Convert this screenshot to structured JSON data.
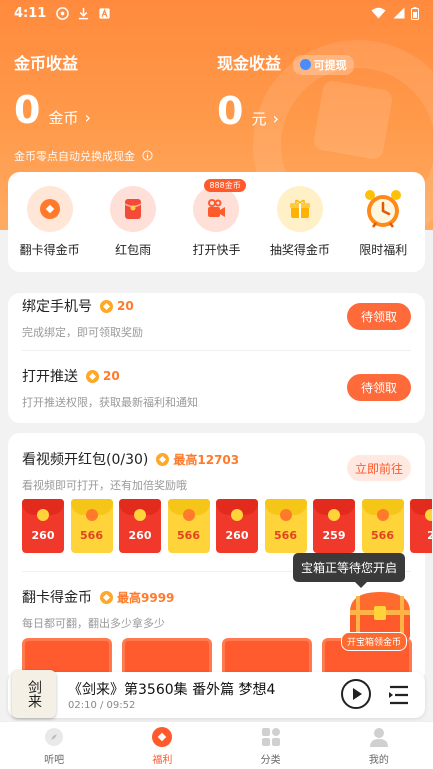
{
  "status": {
    "time": "4:11"
  },
  "earnings": {
    "coin_title": "金币收益",
    "coin_value": "0",
    "coin_unit": "金币",
    "cash_title": "现金收益",
    "cash_tag": "可提现",
    "cash_value": "0",
    "cash_unit": "元",
    "note": "金币零点自动兑换成现金"
  },
  "quick_actions": [
    {
      "label": "翻卡得金币",
      "icon": "card-flip-icon",
      "color": "#ffe6d6"
    },
    {
      "label": "红包雨",
      "icon": "red-packet-icon",
      "color": "#ffe0d8"
    },
    {
      "label": "打开快手",
      "icon": "kuaishou-icon",
      "color": "#ffe0d8",
      "badge": "888金币"
    },
    {
      "label": "抽奖得金币",
      "icon": "gift-box-icon",
      "color": "#fff0c8"
    },
    {
      "label": "限时福利",
      "icon": "alarm-clock-icon",
      "color": "#ffffff"
    }
  ],
  "tasks": [
    {
      "title": "绑定手机号",
      "points": "20",
      "desc": "完成绑定，即可领取奖励",
      "button": "待领取"
    },
    {
      "title": "打开推送",
      "points": "20",
      "desc": "打开推送权限，获取最新福利和通知",
      "button": "待领取"
    }
  ],
  "video_task": {
    "title": "看视频开红包(0/30)",
    "max": "最高12703",
    "desc": "看视频即可打开，还有加倍奖励哦",
    "button": "立即前往",
    "envelopes": [
      {
        "amount": "260",
        "kind": "red"
      },
      {
        "amount": "566",
        "kind": "gold"
      },
      {
        "amount": "260",
        "kind": "red"
      },
      {
        "amount": "566",
        "kind": "gold"
      },
      {
        "amount": "260",
        "kind": "red"
      },
      {
        "amount": "566",
        "kind": "gold"
      },
      {
        "amount": "259",
        "kind": "red"
      },
      {
        "amount": "566",
        "kind": "gold"
      },
      {
        "amount": "2",
        "kind": "red"
      }
    ]
  },
  "flip_task": {
    "title": "翻卡得金币",
    "max": "最高9999",
    "desc": "每日都可翻，翻出多少拿多少"
  },
  "chest": {
    "tooltip": "宝箱正等待您开启",
    "label": "开宝箱领金币"
  },
  "player": {
    "cover_text": "剑来",
    "title": "《剑来》第3560集 番外篇 梦想4",
    "time": "02:10 / 09:52"
  },
  "tabs": [
    {
      "label": "听吧",
      "icon": "compass-icon",
      "active": false
    },
    {
      "label": "福利",
      "icon": "welfare-coin-icon",
      "active": true
    },
    {
      "label": "分类",
      "icon": "category-grid-icon",
      "active": false
    },
    {
      "label": "我的",
      "icon": "profile-icon",
      "active": false
    }
  ],
  "colors": {
    "accent": "#ff6a3a",
    "red_env": "#f0392b",
    "gold_env": "#ffd43b"
  }
}
